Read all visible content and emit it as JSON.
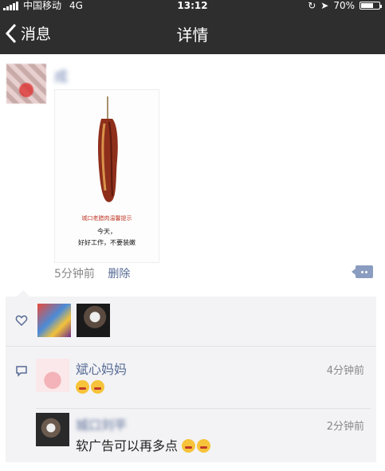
{
  "status_bar": {
    "carrier": "中国移动",
    "network": "4G",
    "time": "13:12",
    "battery": "70%",
    "battery_level": 0.7
  },
  "nav": {
    "back_label": "消息",
    "title": "详情"
  },
  "post": {
    "author": "成",
    "poster": {
      "caption_line1": "城口老腊肉温馨提示",
      "caption_line2": "今天，",
      "caption_line3": "好好工作，不要装嫩"
    },
    "time": "5分钟前",
    "delete_label": "删除"
  },
  "likes": {
    "icon": "heart-icon",
    "count": 2
  },
  "comments": [
    {
      "author": "斌心妈妈",
      "time": "4分钟前",
      "text": ""
    },
    {
      "author": "城口刘平",
      "time": "2分钟前",
      "text": "软广告可以再多点"
    }
  ],
  "colors": {
    "nav_bg": "#2e2e2e",
    "link": "#576b95",
    "meta": "#888888",
    "panel_bg": "#f3f3f5"
  }
}
